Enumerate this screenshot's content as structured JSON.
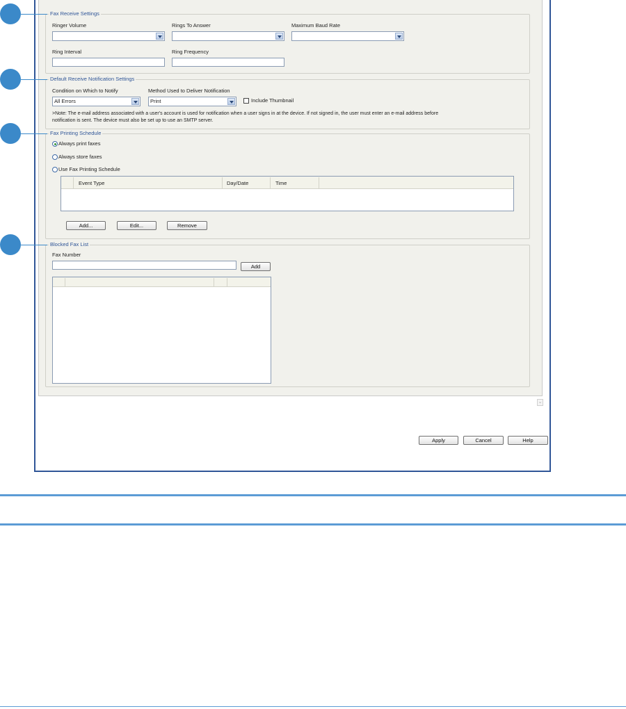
{
  "fax_receive": {
    "legend": "Fax Receive Settings",
    "ringer_volume_label": "Ringer Volume",
    "ringer_volume_value": "",
    "rings_to_answer_label": "Rings To Answer",
    "rings_to_answer_value": "",
    "max_baud_label": "Maximum Baud Rate",
    "max_baud_value": "",
    "ring_interval_label": "Ring Interval",
    "ring_interval_value": "",
    "ring_frequency_label": "Ring Frequency",
    "ring_frequency_value": ""
  },
  "notification": {
    "legend": "Default Receive Notification Settings",
    "condition_label": "Condition on Which to Notify",
    "condition_value": "All Errors",
    "method_label": "Method Used to Deliver Notification",
    "method_value": "Print",
    "thumbnail_label": "Include Thumbnail",
    "thumbnail_checked": false,
    "note_line1": ">Note: The e-mail address associated with a user's account is used for notification when a user signs in at the device. If not signed in, the user must enter an e-mail address before",
    "note_line2": "notification is sent. The device must also be set up to use an SMTP server."
  },
  "schedule": {
    "legend": "Fax Printing Schedule",
    "options": [
      "Always print faxes",
      "Always store faxes",
      "Use Fax Printing Schedule"
    ],
    "selected_index": 0,
    "columns": [
      "Event Type",
      "Day/Date",
      "Time"
    ],
    "rows": [],
    "add_label": "Add...",
    "edit_label": "Edit...",
    "remove_label": "Remove"
  },
  "blocked": {
    "legend": "Blocked Fax List",
    "fax_number_label": "Fax Number",
    "fax_number_value": "",
    "add_label": "Add",
    "rows": []
  },
  "footer": {
    "apply_label": "Apply",
    "cancel_label": "Cancel",
    "help_label": "Help"
  },
  "colors": {
    "callout": "#3b89c9",
    "legend_text": "#2f5597",
    "window_border": "#2f5597",
    "panel_bg": "#f1f1ec",
    "page_rule": "#5b9bd5"
  }
}
